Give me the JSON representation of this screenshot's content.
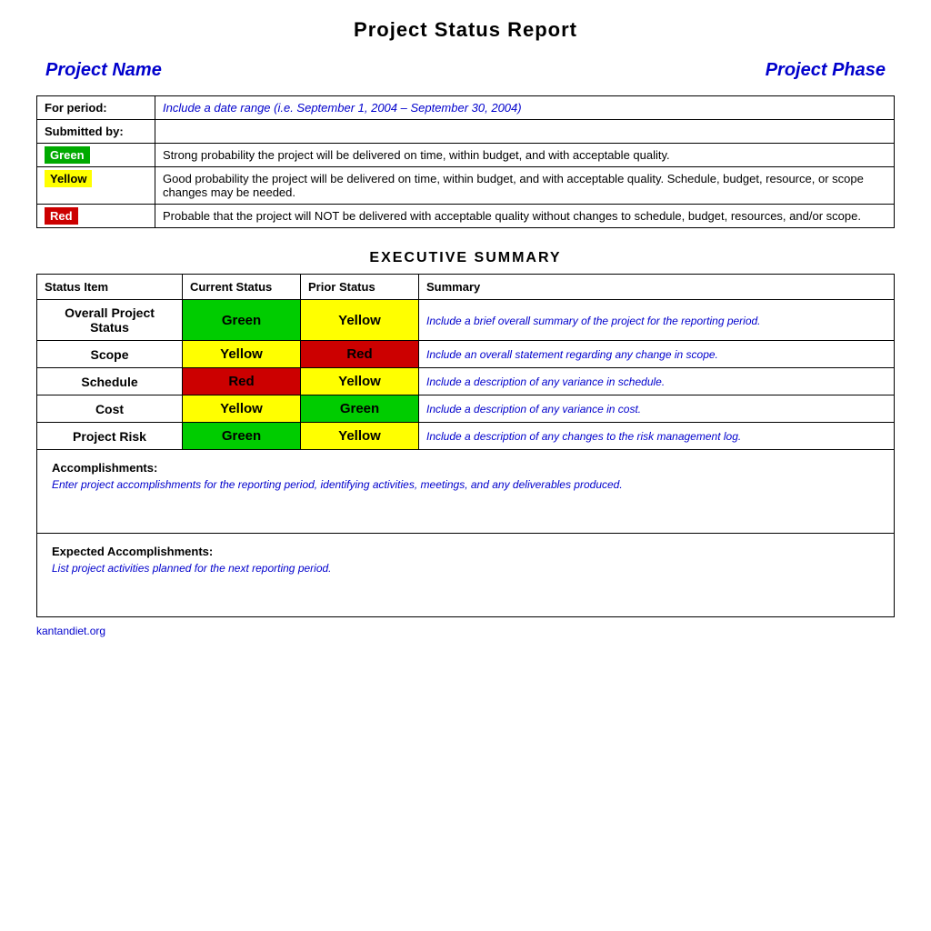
{
  "page": {
    "title": "Project Status Report"
  },
  "header": {
    "project_name_label": "Project Name",
    "project_phase_label": "Project Phase"
  },
  "info_section": {
    "for_period_label": "For period:",
    "for_period_value": "Include a date range (i.e. September 1, 2004 – September 30, 2004)",
    "submitted_by_label": "Submitted by:",
    "submitted_by_value": ""
  },
  "legend": [
    {
      "color_label": "Green",
      "color_type": "green",
      "description": "Strong probability the project will be delivered on time, within budget, and with acceptable quality."
    },
    {
      "color_label": "Yellow",
      "color_type": "yellow",
      "description": "Good probability the project will be delivered on time, within budget, and with acceptable quality. Schedule, budget, resource, or scope changes may be needed."
    },
    {
      "color_label": "Red",
      "color_type": "red",
      "description": "Probable that the project will NOT be delivered with acceptable quality without changes to schedule, budget, resources, and/or scope."
    }
  ],
  "executive_summary": {
    "title": "EXECUTIVE SUMMARY",
    "columns": {
      "status_item": "Status Item",
      "current_status": "Current Status",
      "prior_status": "Prior Status",
      "summary": "Summary"
    },
    "rows": [
      {
        "status_item": "Overall Project\nStatus",
        "current_status": "Green",
        "current_type": "green",
        "prior_status": "Yellow",
        "prior_type": "yellow",
        "summary": "Include a brief overall summary of the project for the reporting period."
      },
      {
        "status_item": "Scope",
        "current_status": "Yellow",
        "current_type": "yellow",
        "prior_status": "Red",
        "prior_type": "red",
        "summary": "Include an overall statement regarding any change in scope."
      },
      {
        "status_item": "Schedule",
        "current_status": "Red",
        "current_type": "red",
        "prior_status": "Yellow",
        "prior_type": "yellow",
        "summary": "Include a description of any variance in schedule."
      },
      {
        "status_item": "Cost",
        "current_status": "Yellow",
        "current_type": "yellow",
        "prior_status": "Green",
        "prior_type": "green",
        "summary": "Include a description of any variance in cost."
      },
      {
        "status_item": "Project Risk",
        "current_status": "Green",
        "current_type": "green",
        "prior_status": "Yellow",
        "prior_type": "yellow",
        "summary": "Include a description of any changes to the risk management log."
      }
    ],
    "accomplishments_label": "Accomplishments:",
    "accomplishments_text": "Enter project accomplishments for the reporting period, identifying activities, meetings, and any deliverables produced.",
    "expected_accomplishments_label": "Expected Accomplishments:",
    "expected_accomplishments_text": "List project activities planned for the next reporting period."
  },
  "footer": {
    "watermark": "kantandiet.org"
  }
}
